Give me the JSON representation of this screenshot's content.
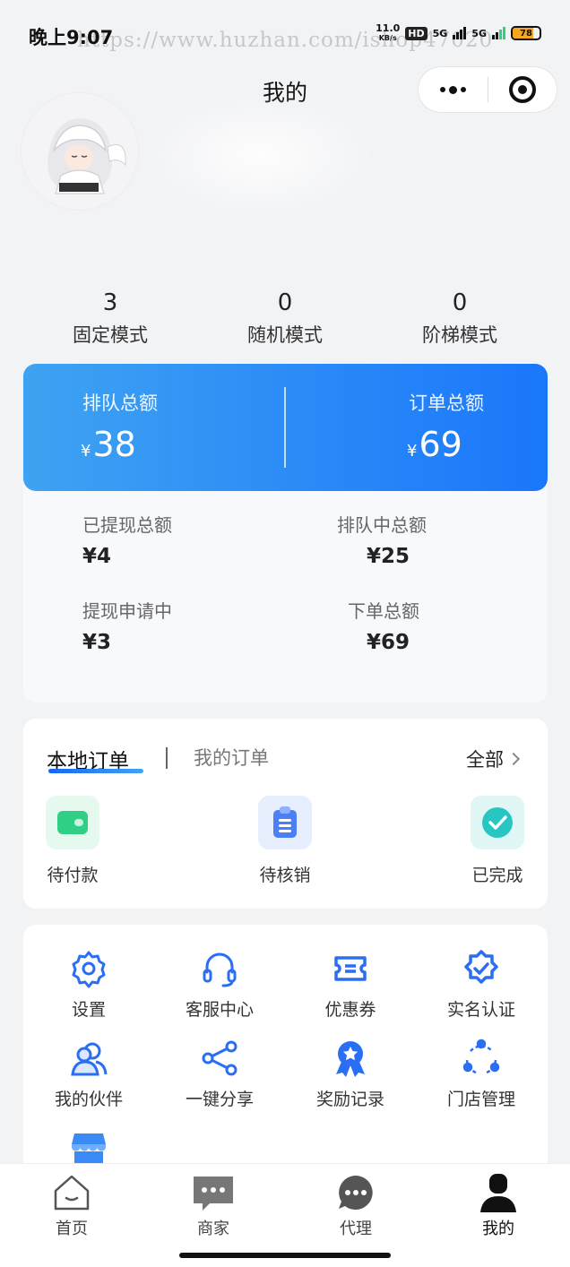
{
  "status_bar": {
    "time": "晚上9:07",
    "watermark": "https://www.huzhan.com/ishop47020",
    "net_speed": "11.0",
    "net_unit": "KB/s",
    "hd": "HD",
    "sig1": "5G",
    "sig2": "5G",
    "battery": "78",
    "battery_level": 0.78,
    "battery_color": "#f5a623"
  },
  "nav": {
    "title": "我的",
    "more_icon": "more-dots-icon",
    "close_icon": "target-close-icon"
  },
  "stats": [
    {
      "value": "3",
      "label": "固定模式"
    },
    {
      "value": "0",
      "label": "随机模式"
    },
    {
      "value": "0",
      "label": "阶梯模式"
    }
  ],
  "summary": {
    "currency": "¥",
    "queue_total_label": "排队总额",
    "queue_total_value": "38",
    "order_total_label": "订单总额",
    "order_total_value": "69",
    "withdrawn_label": "已提现总额",
    "withdrawn_value": "¥4",
    "queuing_label": "排队中总额",
    "queuing_value": "¥25",
    "withdraw_pending_label": "提现申请中",
    "withdraw_pending_value": "¥3",
    "ordered_label": "下单总额",
    "ordered_value": "¥69"
  },
  "orders": {
    "tab_local": "本地订单",
    "tab_mine": "我的订单",
    "all_label": "全部",
    "items": [
      {
        "label": "待付款",
        "icon": "wallet-icon",
        "color": "#2fcf86"
      },
      {
        "label": "待核销",
        "icon": "clipboard-icon",
        "color": "#4a7ff5"
      },
      {
        "label": "已完成",
        "icon": "check-circle-icon",
        "color": "#27c6c2"
      }
    ]
  },
  "services": [
    {
      "label": "设置",
      "icon": "gear-icon"
    },
    {
      "label": "客服中心",
      "icon": "headset-icon"
    },
    {
      "label": "优惠券",
      "icon": "coupon-icon"
    },
    {
      "label": "实名认证",
      "icon": "verified-badge-icon"
    },
    {
      "label": "我的伙伴",
      "icon": "partners-icon"
    },
    {
      "label": "一键分享",
      "icon": "share-icon"
    },
    {
      "label": "奖励记录",
      "icon": "award-ribbon-icon"
    },
    {
      "label": "门店管理",
      "icon": "store-cycle-icon"
    },
    {
      "label": "",
      "icon": "storefront-icon"
    }
  ],
  "tabbar": [
    {
      "label": "首页",
      "icon": "home-icon"
    },
    {
      "label": "商家",
      "icon": "chat-square-icon"
    },
    {
      "label": "代理",
      "icon": "chat-bubble-icon"
    },
    {
      "label": "我的",
      "icon": "person-icon",
      "active": true
    }
  ],
  "colors": {
    "accent": "#1a77fb",
    "accent_light": "#3ea3f2",
    "service_icon": "#2a6ff3"
  }
}
